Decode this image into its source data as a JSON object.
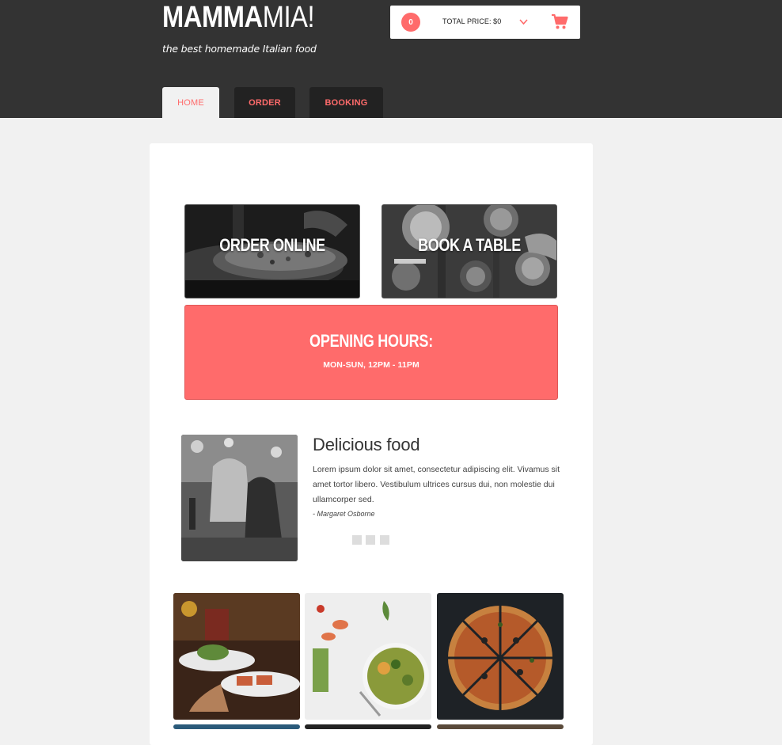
{
  "brand": {
    "name_bold": "MAMMA",
    "name_light": "MIA!",
    "tagline": "the best homemade Italian food"
  },
  "cart": {
    "count": "0",
    "total_label": "TOTAL PRICE: $0",
    "icons": [
      "chevron-down-icon",
      "shopping-cart-icon"
    ]
  },
  "nav": {
    "tabs": [
      {
        "label": "HOME",
        "active": true
      },
      {
        "label": "ORDER",
        "active": false
      },
      {
        "label": "BOOKING",
        "active": false
      }
    ]
  },
  "tiles": {
    "order": "ORDER ONLINE",
    "book": "BOOK A TABLE"
  },
  "hours": {
    "title": "OPENING HOURS:",
    "time": "MON-SUN, 12PM - 11PM"
  },
  "testimonial": {
    "title": "Delicious food",
    "body": "Lorem ipsum dolor sit amet, consectetur adipiscing elit. Vivamus sit amet tortor libero. Vestibulum ultrices cursus dui, non molestie dui ullamcorper sed.",
    "author": "- Margaret Osborne",
    "dots": 3
  },
  "colors": {
    "accent": "#ff6b6b",
    "header": "#333333",
    "tab": "#222222",
    "page": "#f1f1f1"
  }
}
